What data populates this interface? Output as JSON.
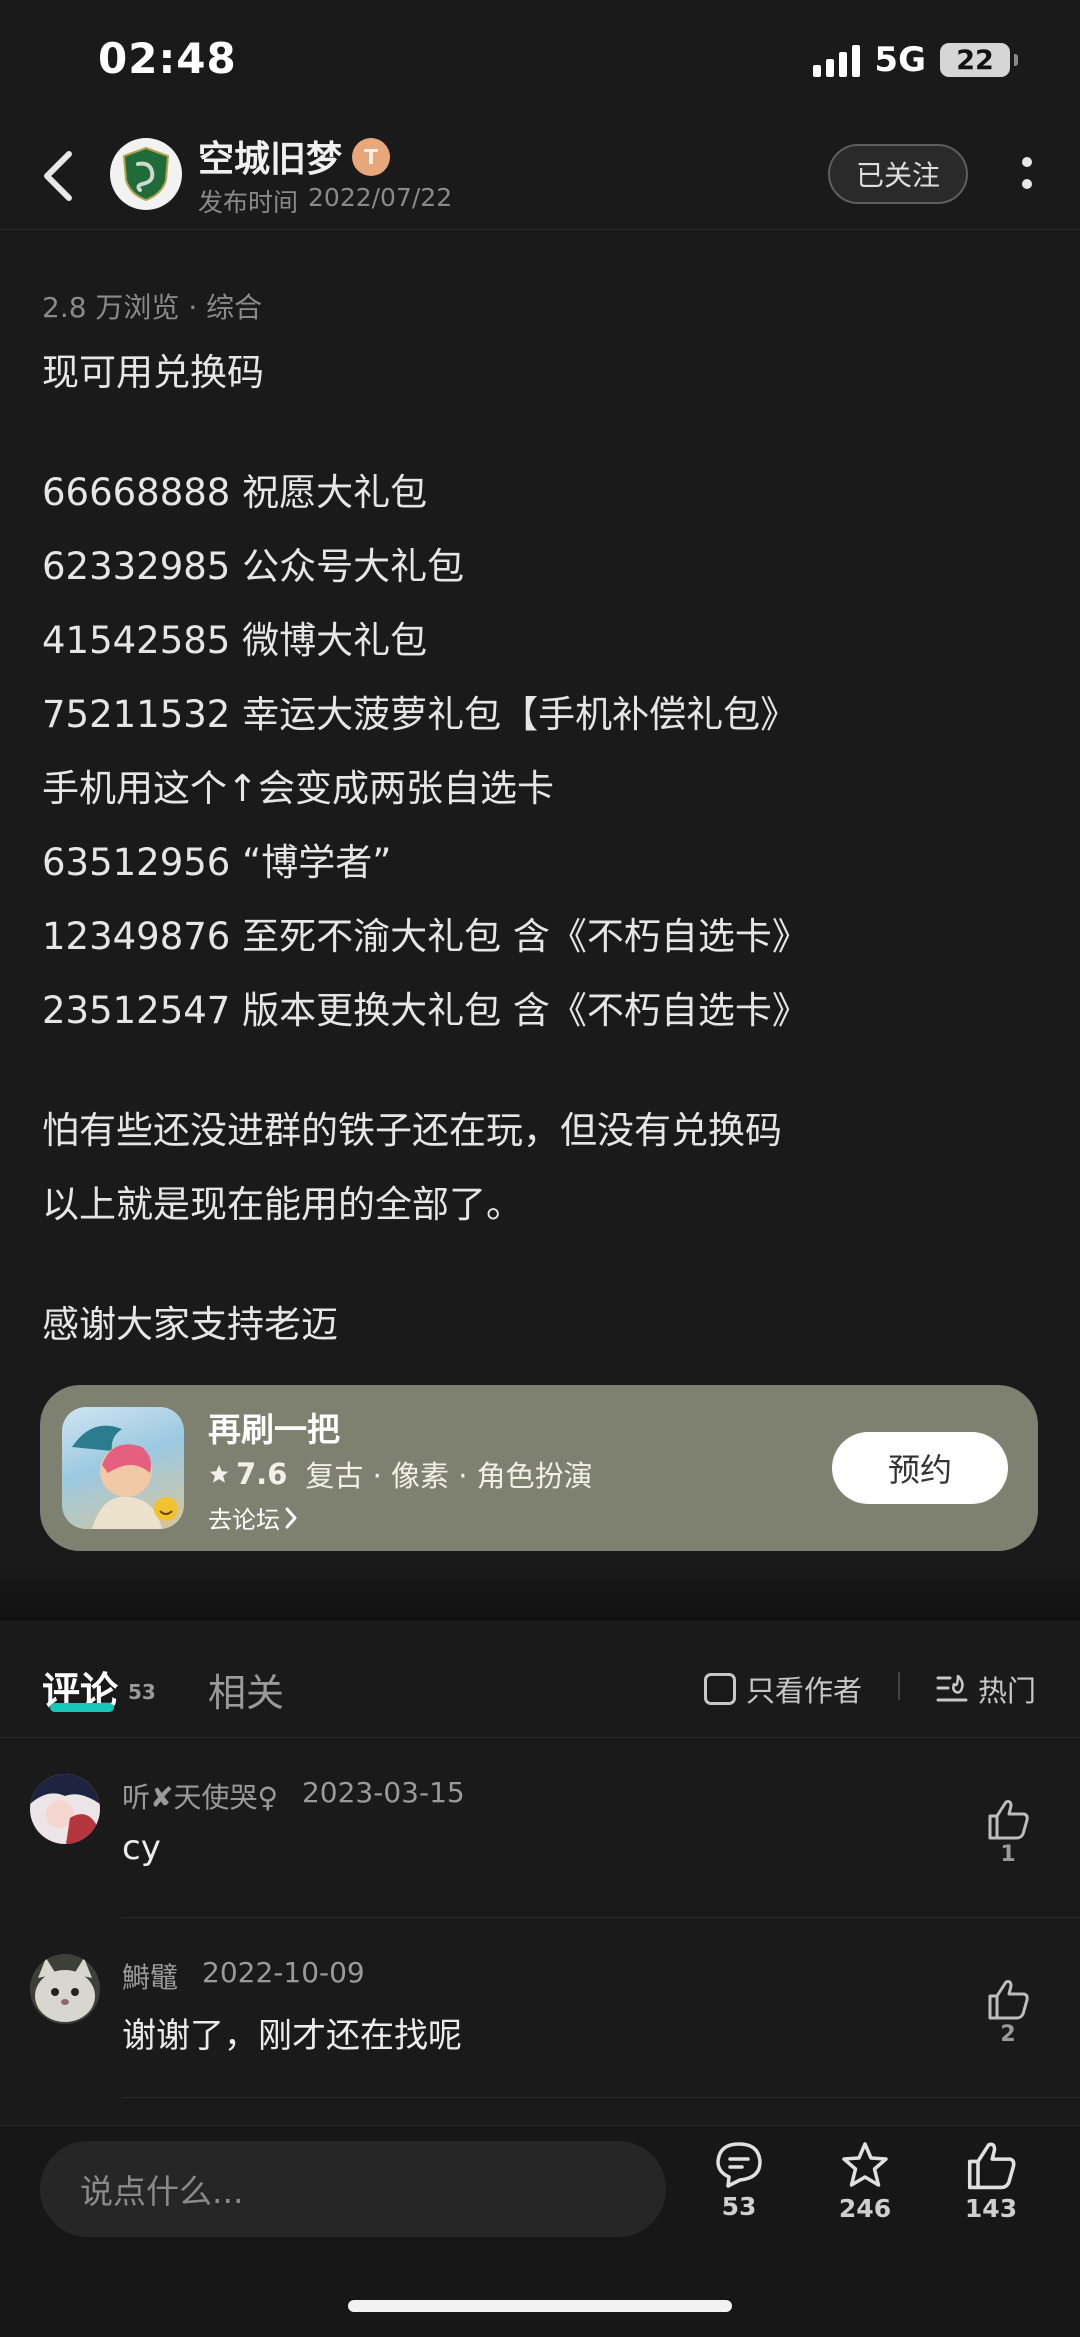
{
  "status_bar": {
    "time": "02:48",
    "network": "5G",
    "battery": "22"
  },
  "header": {
    "author_name": "空城旧梦",
    "author_badge": "T",
    "publish_label": "发布时间",
    "publish_date": "2022/07/22",
    "follow_label": "已关注"
  },
  "article": {
    "meta": "2.8 万浏览 · 综合",
    "paragraphs": [
      [
        "现可用兑换码"
      ],
      [
        "66668888 祝愿大礼包",
        "62332985 公众号大礼包",
        "41542585 微博大礼包",
        "75211532 幸运大菠萝礼包【手机补偿礼包》",
        "手机用这个↑会变成两张自选卡",
        "63512956 “博学者”",
        "12349876 至死不渝大礼包 含《不朽自选卡》",
        "23512547 版本更换大礼包 含《不朽自选卡》"
      ],
      [
        "怕有些还没进群的铁子还在玩，但没有兑换码",
        "以上就是现在能用的全部了。"
      ],
      [
        "感谢大家支持老迈"
      ]
    ]
  },
  "game_card": {
    "name": "再刷一把",
    "rating": "7.6",
    "tags": "复古 · 像素 · 角色扮演",
    "forum_link": "去论坛",
    "reserve_label": "预约"
  },
  "tabs": {
    "comments_label": "评论",
    "comments_count": "53",
    "related_label": "相关",
    "author_only_label": "只看作者",
    "sort_label": "热门"
  },
  "comments": [
    {
      "user": "听✘天使哭♀",
      "date": "2023-03-15",
      "text": "cy",
      "likes": "1"
    },
    {
      "user": "鰣鼊",
      "date": "2022-10-09",
      "text": "谢谢了，刚才还在找呢",
      "likes": "2"
    }
  ],
  "bottom_bar": {
    "input_placeholder": "说点什么...",
    "comment_count": "53",
    "favorite_count": "246",
    "like_count": "143"
  },
  "icons": [
    "back-icon",
    "more-icon",
    "star-icon",
    "chevron-right-icon",
    "hot-sort-icon",
    "thumb-up-icon",
    "comment-bubble-icon",
    "favorite-star-icon"
  ],
  "colors": {
    "accent": "#18c6b7",
    "card_bg": "#7e8070",
    "page_bg": "#1a1a1a"
  }
}
